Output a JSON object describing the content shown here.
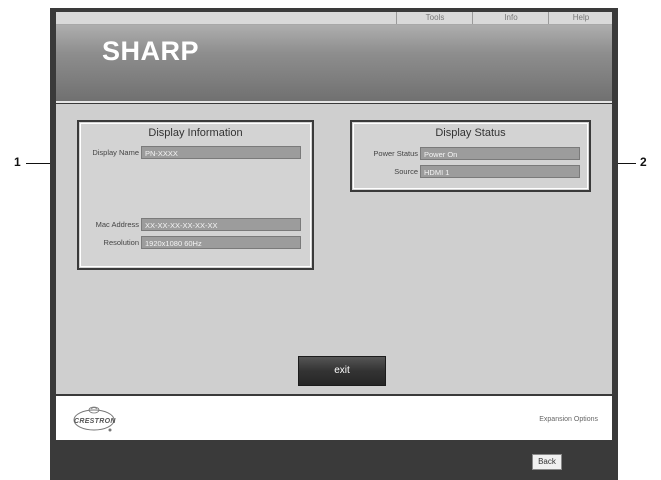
{
  "menu": {
    "items": [
      "Tools",
      "Info",
      "Help"
    ]
  },
  "brand": {
    "logo": "SHARP"
  },
  "display_information": {
    "title": "Display Information",
    "fields": [
      {
        "label": "Display Name",
        "value": "PN-XXXX"
      },
      {
        "label": "Mac Address",
        "value": "XX-XX-XX-XX-XX-XX"
      },
      {
        "label": "Resolution",
        "value": "1920x1080  60Hz"
      }
    ]
  },
  "display_status": {
    "title": "Display Status",
    "fields": [
      {
        "label": "Power Status",
        "value": "Power On"
      },
      {
        "label": "Source",
        "value": "HDMI 1"
      }
    ]
  },
  "buttons": {
    "exit": "exit",
    "back": "Back"
  },
  "footer": {
    "crestron_logo": "CRESTRON",
    "expansion_options": "Expansion Options"
  },
  "callouts": {
    "left": "1",
    "right": "2"
  },
  "colors": {
    "frame": "#3a3a3a",
    "content_bg": "#cfcfcf",
    "field_bg": "#9c9c9c"
  }
}
